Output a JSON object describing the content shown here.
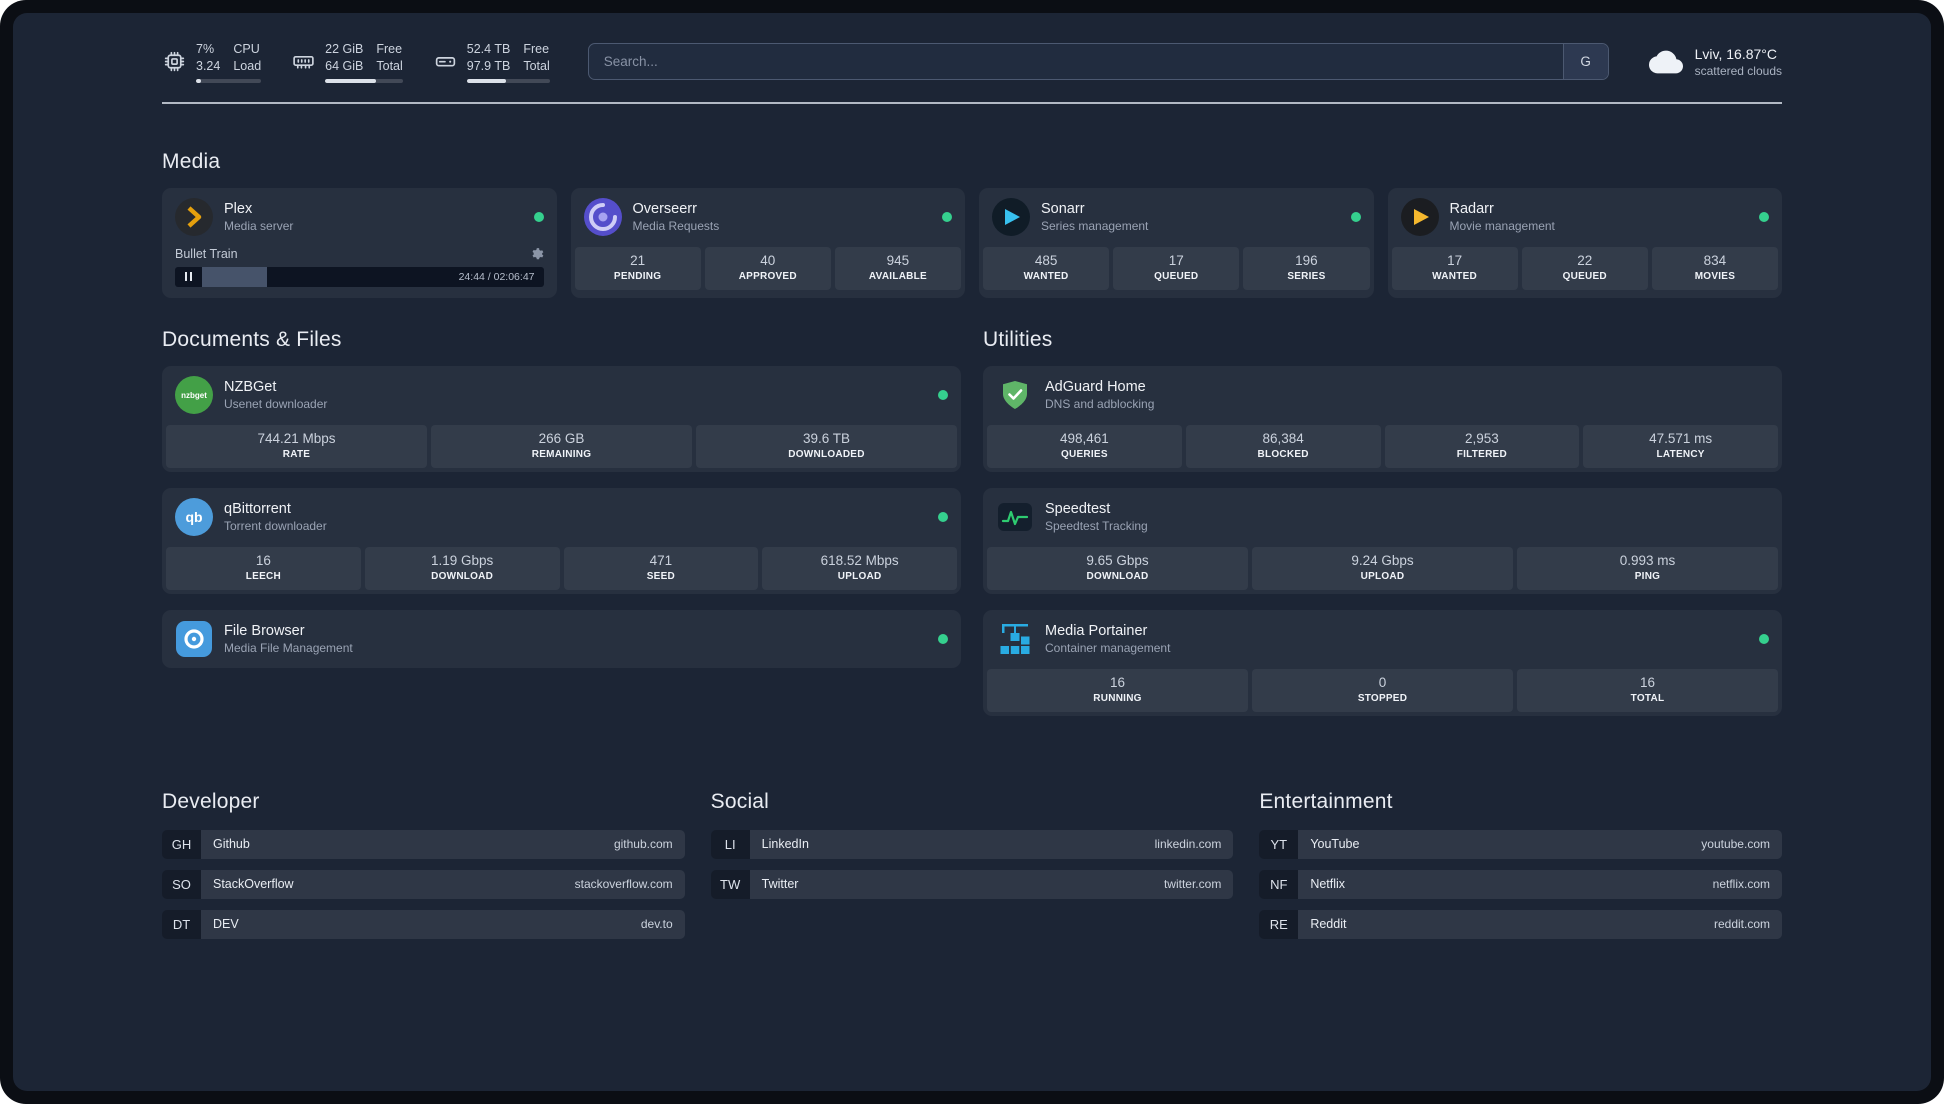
{
  "topbar": {
    "cpu": {
      "value_top": "7%",
      "value_bottom": "3.24",
      "label_top": "CPU",
      "label_bottom": "Load",
      "fill_pct": 7
    },
    "memory": {
      "value_top": "22 GiB",
      "value_bottom": "64 GiB",
      "label_top": "Free",
      "label_bottom": "Total",
      "fill_pct": 66
    },
    "disk": {
      "value_top": "52.4 TB",
      "value_bottom": "97.9 TB",
      "label_top": "Free",
      "label_bottom": "Total",
      "fill_pct": 47
    },
    "search": {
      "placeholder": "Search...",
      "provider": "G"
    },
    "weather": {
      "location": "Lviv, 16.87°C",
      "condition": "scattered clouds"
    }
  },
  "groups": {
    "media": "Media",
    "documents": "Documents & Files",
    "utilities": "Utilities"
  },
  "services": {
    "plex": {
      "name": "Plex",
      "subtitle": "Media server",
      "player": {
        "title": "Bullet Train",
        "time": "24:44 / 02:06:47",
        "progress_pct": 19
      }
    },
    "overseerr": {
      "name": "Overseerr",
      "subtitle": "Media Requests",
      "stats": [
        {
          "value": "21",
          "label": "PENDING"
        },
        {
          "value": "40",
          "label": "APPROVED"
        },
        {
          "value": "945",
          "label": "AVAILABLE"
        }
      ]
    },
    "sonarr": {
      "name": "Sonarr",
      "subtitle": "Series management",
      "stats": [
        {
          "value": "485",
          "label": "WANTED"
        },
        {
          "value": "17",
          "label": "QUEUED"
        },
        {
          "value": "196",
          "label": "SERIES"
        }
      ]
    },
    "radarr": {
      "name": "Radarr",
      "subtitle": "Movie management",
      "stats": [
        {
          "value": "17",
          "label": "WANTED"
        },
        {
          "value": "22",
          "label": "QUEUED"
        },
        {
          "value": "834",
          "label": "MOVIES"
        }
      ]
    },
    "nzbget": {
      "name": "NZBGet",
      "subtitle": "Usenet downloader",
      "stats": [
        {
          "value": "744.21 Mbps",
          "label": "RATE"
        },
        {
          "value": "266 GB",
          "label": "REMAINING"
        },
        {
          "value": "39.6 TB",
          "label": "DOWNLOADED"
        }
      ]
    },
    "qbittorrent": {
      "name": "qBittorrent",
      "subtitle": "Torrent downloader",
      "stats": [
        {
          "value": "16",
          "label": "LEECH"
        },
        {
          "value": "1.19 Gbps",
          "label": "DOWNLOAD"
        },
        {
          "value": "471",
          "label": "SEED"
        },
        {
          "value": "618.52 Mbps",
          "label": "UPLOAD"
        }
      ]
    },
    "filebrowser": {
      "name": "File Browser",
      "subtitle": "Media File Management"
    },
    "adguard": {
      "name": "AdGuard Home",
      "subtitle": "DNS and adblocking",
      "stats": [
        {
          "value": "498,461",
          "label": "QUERIES"
        },
        {
          "value": "86,384",
          "label": "BLOCKED"
        },
        {
          "value": "2,953",
          "label": "FILTERED"
        },
        {
          "value": "47.571 ms",
          "label": "LATENCY"
        }
      ]
    },
    "speedtest": {
      "name": "Speedtest",
      "subtitle": "Speedtest Tracking",
      "stats": [
        {
          "value": "9.65 Gbps",
          "label": "DOWNLOAD"
        },
        {
          "value": "9.24 Gbps",
          "label": "UPLOAD"
        },
        {
          "value": "0.993 ms",
          "label": "PING"
        }
      ]
    },
    "portainer": {
      "name": "Media Portainer",
      "subtitle": "Container management",
      "stats": [
        {
          "value": "16",
          "label": "RUNNING"
        },
        {
          "value": "0",
          "label": "STOPPED"
        },
        {
          "value": "16",
          "label": "TOTAL"
        }
      ]
    }
  },
  "bookmarks": {
    "developer": {
      "title": "Developer",
      "items": [
        {
          "abbr": "GH",
          "name": "Github",
          "url": "github.com"
        },
        {
          "abbr": "SO",
          "name": "StackOverflow",
          "url": "stackoverflow.com"
        },
        {
          "abbr": "DT",
          "name": "DEV",
          "url": "dev.to"
        }
      ]
    },
    "social": {
      "title": "Social",
      "items": [
        {
          "abbr": "LI",
          "name": "LinkedIn",
          "url": "linkedin.com"
        },
        {
          "abbr": "TW",
          "name": "Twitter",
          "url": "twitter.com"
        }
      ]
    },
    "entertainment": {
      "title": "Entertainment",
      "items": [
        {
          "abbr": "YT",
          "name": "YouTube",
          "url": "youtube.com"
        },
        {
          "abbr": "NF",
          "name": "Netflix",
          "url": "netflix.com"
        },
        {
          "abbr": "RE",
          "name": "Reddit",
          "url": "reddit.com"
        }
      ]
    }
  },
  "colors": {
    "page_bg": "#1c2535",
    "status_online": "#35d08e",
    "plex_accent": "#e5a00d",
    "sonarr_accent": "#38c1ef",
    "radarr_accent": "#f5b82e",
    "nzbget_accent": "#43a047",
    "qbittorrent_accent": "#4d9cdb",
    "adguard_accent": "#5fb568",
    "speedtest_accent": "#2ecc71",
    "portainer_accent": "#29abe2"
  }
}
